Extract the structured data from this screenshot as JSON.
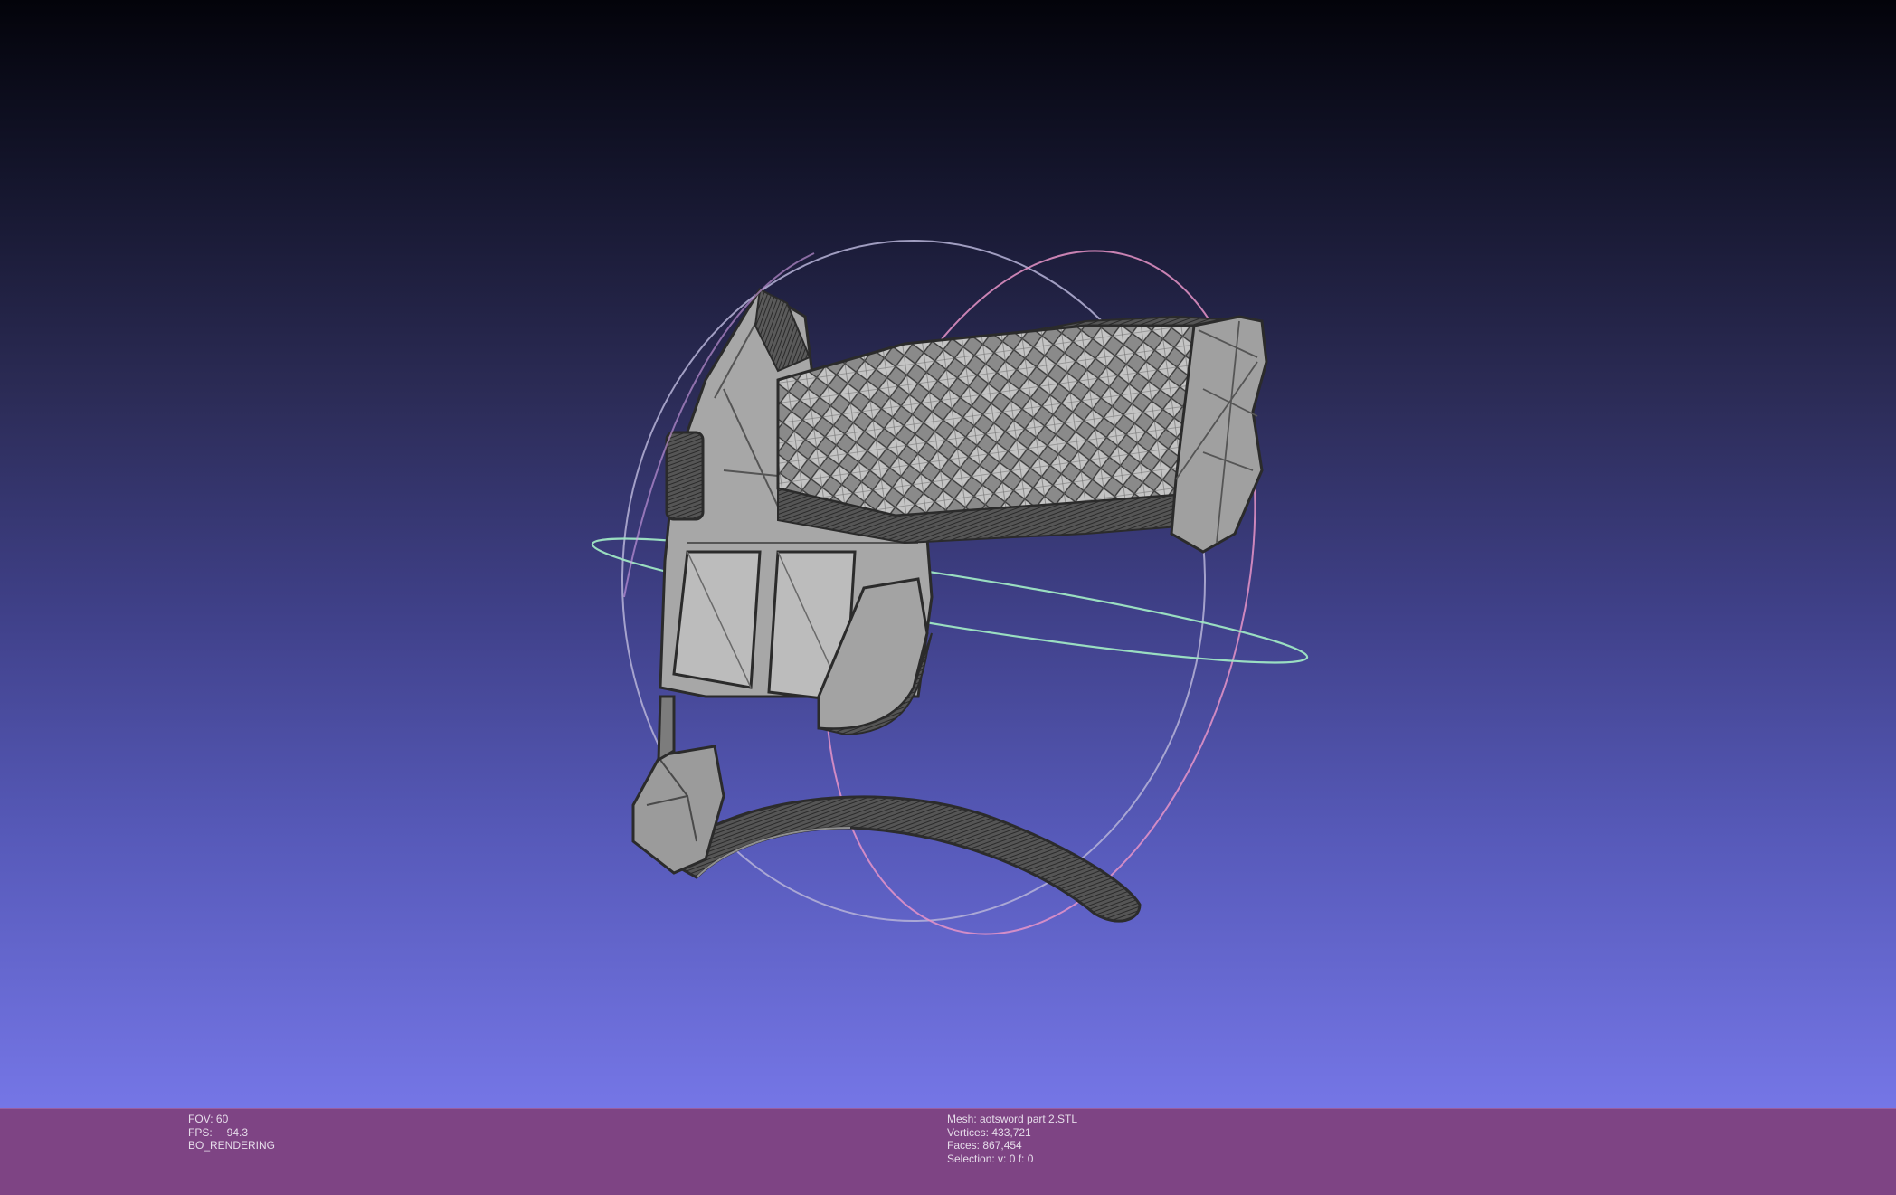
{
  "viewer": {
    "background_top": "#03030a",
    "background_bottom": "#7576e6",
    "status_bar_color": "#7e4484"
  },
  "status_left": {
    "fov_label": "FOV: 60",
    "fps_label": "FPS:",
    "fps_value": "94.3",
    "render_mode": "BO_RENDERING"
  },
  "status_right": {
    "mesh": "Mesh: aotsword part 2.STL",
    "vertices": "Vertices: 433,721",
    "faces": "Faces: 867,454",
    "selection": "Selection: v: 0 f: 0"
  },
  "trackball": {
    "ring_colors": [
      "#b7b4d8",
      "#9fe7c4",
      "#e894c8"
    ]
  },
  "mesh_color": "#9a9a9a"
}
